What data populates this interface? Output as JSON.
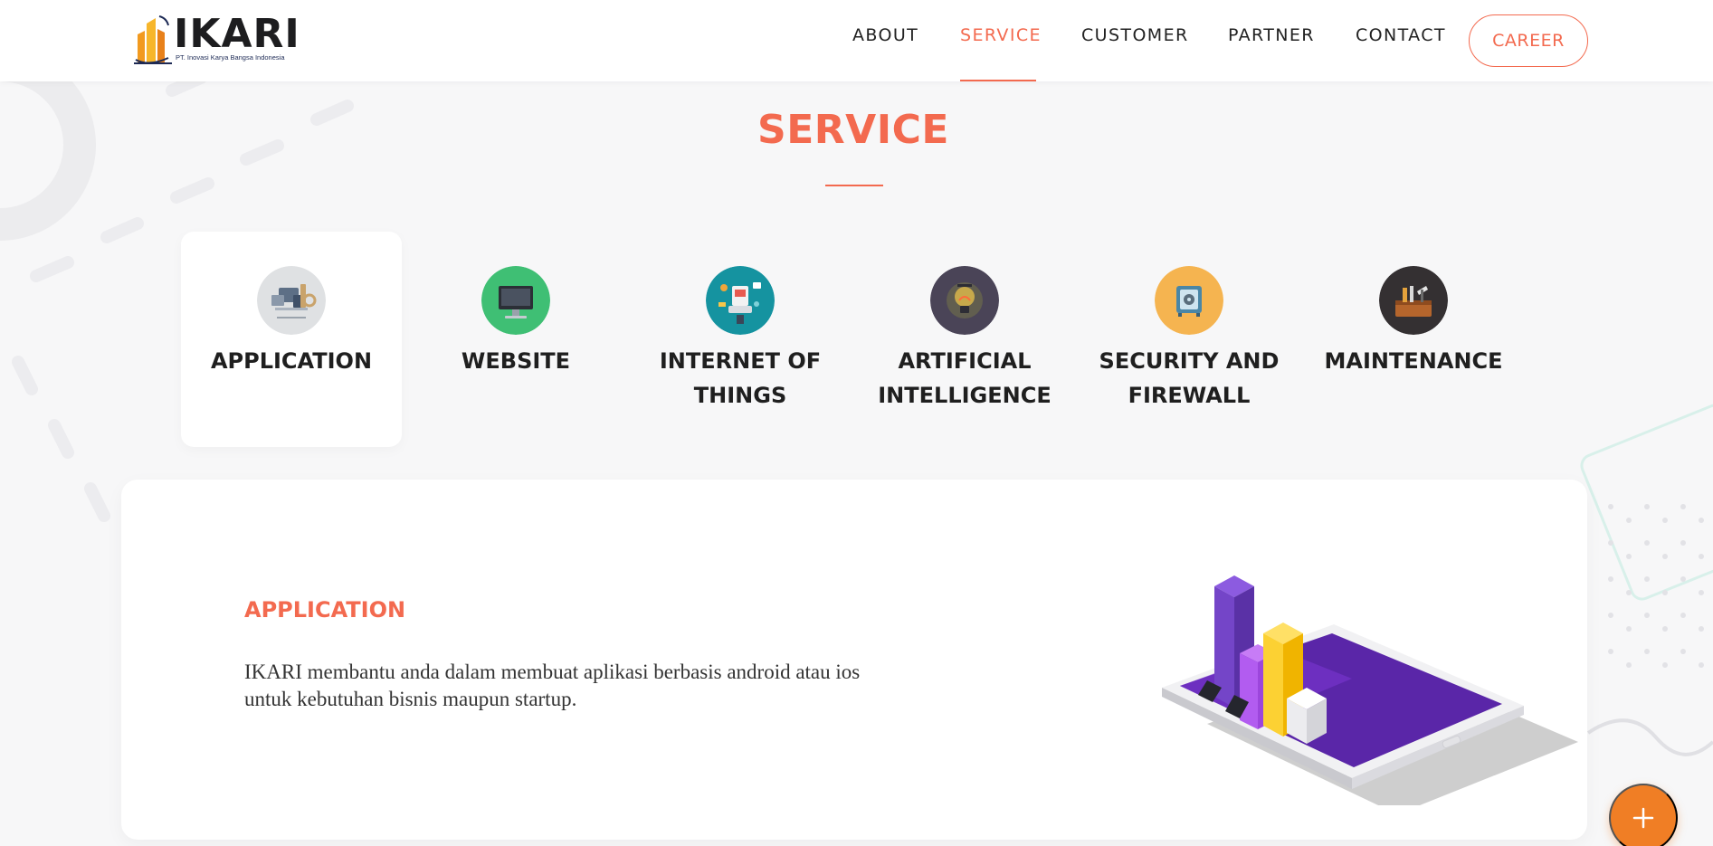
{
  "brand": {
    "name": "IKARI",
    "tagline": "PT. Inovasi Karya Bangsa Indonesia"
  },
  "nav": {
    "items": [
      {
        "label": "ABOUT",
        "active": false
      },
      {
        "label": "SERVICE",
        "active": true
      },
      {
        "label": "CUSTOMER",
        "active": false
      },
      {
        "label": "PARTNER",
        "active": false
      },
      {
        "label": "CONTACT",
        "active": false
      }
    ],
    "career_label": "CAREER"
  },
  "section": {
    "title": "SERVICE"
  },
  "services": [
    {
      "label": "APPLICATION",
      "icon": "app-development-icon",
      "active": true
    },
    {
      "label": "WEBSITE",
      "icon": "monitor-icon",
      "active": false
    },
    {
      "label": "INTERNET OF THINGS",
      "icon": "iot-devices-icon",
      "active": false
    },
    {
      "label": "ARTIFICIAL INTELLIGENCE",
      "icon": "ai-bulb-icon",
      "active": false
    },
    {
      "label": "SECURITY AND FIREWALL",
      "icon": "safe-lock-icon",
      "active": false
    },
    {
      "label": "MAINTENANCE",
      "icon": "toolbox-icon",
      "active": false
    }
  ],
  "detail": {
    "heading": "APPLICATION",
    "description": "IKARI membantu anda dalam membuat aplikasi berbasis android atau ios untuk kebutuhan bisnis maupun startup."
  },
  "colors": {
    "accent": "#f36a4f",
    "fab": "#f07e25"
  },
  "fab_icon": "plus-icon"
}
